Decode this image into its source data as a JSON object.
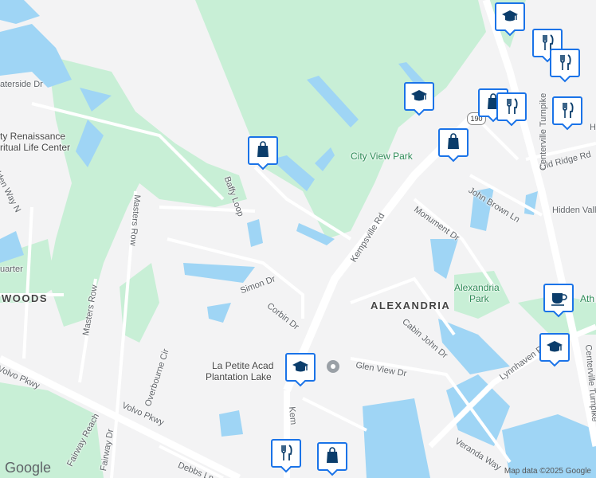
{
  "map": {
    "labels": {
      "waterside_dr": "aterside Dr",
      "renaissance": "ty Renaissance",
      "life_center": "ritual Life Center",
      "hidden_way": "dden Way N",
      "baffy_loop": "Baffy Loop",
      "masters_row_1": "Masters Row",
      "masters_row_2": "Masters Row",
      "quarter": "uarter",
      "woods": "WOODS",
      "simon_dr": "Simon Dr",
      "corbin_dr": "Corbin Dr",
      "kempsville_rd": "Kempsville Rd",
      "kempsville_rd_2": "Kem",
      "city_view_park": "City View Park",
      "john_brown_ln": "John Brown Ln",
      "monument_dr": "Monument Dr",
      "old_ridge_rd": "Old Ridge Rd",
      "hidden_valley": "Hidden Vall",
      "centerville_tpke_1": "Centerville Turnpike",
      "centerville_tpke_2": "Centerville Turnpike",
      "alexandria": "ALEXANDRIA",
      "alexandria_park_1": "Alexandria",
      "alexandria_park_2": "Park",
      "cabin_john_dr": "Cabin John Dr",
      "lynnhaven_pkwy": "Lynnhaven Pkwy",
      "glen_view_dr": "Glen View Dr",
      "la_petite_1": "La Petite Acad",
      "la_petite_2": "Plantation Lake",
      "overbourne_cir": "Overbourne Cir",
      "volvo_pkwy_1": "Volvo Pkwy",
      "volvo_pkwy_2": "Volvo Pkwy",
      "fairway_reach": "Fairway Reach",
      "fairway_dr": "Fairway Dr",
      "debbs_ln": "Debbs Ln",
      "veranda_way": "Veranda Way",
      "ath": "Ath",
      "h_edge": "H",
      "route_190": "190"
    },
    "attribution": "Map data ©2025 Google",
    "logo": "Google",
    "colors": {
      "water": "#9fd5f5",
      "park": "#c8efd6",
      "land": "#f3f3f4",
      "road": "#ffffff",
      "pin": "#1a73e8",
      "pin_dark": "#0b3d6b"
    },
    "pins": [
      {
        "name": "shopping-pin-golf",
        "icon": "shopping-bag-icon"
      },
      {
        "name": "school-pin-top",
        "icon": "graduation-cap-icon"
      },
      {
        "name": "school-pin-park",
        "icon": "graduation-cap-icon"
      },
      {
        "name": "shopping-pin-kempsville",
        "icon": "shopping-bag-icon"
      },
      {
        "name": "restaurant-pin-1",
        "icon": "fork-knife-icon"
      },
      {
        "name": "restaurant-pin-2",
        "icon": "fork-knife-icon"
      },
      {
        "name": "shopping-pin-cluster",
        "icon": "shopping-bag-icon"
      },
      {
        "name": "restaurant-pin-3",
        "icon": "fork-knife-icon"
      },
      {
        "name": "restaurant-pin-4",
        "icon": "fork-knife-icon"
      },
      {
        "name": "cafe-pin",
        "icon": "coffee-cup-icon"
      },
      {
        "name": "school-pin-lynnhaven",
        "icon": "graduation-cap-icon"
      },
      {
        "name": "school-pin-la-petite",
        "icon": "graduation-cap-icon"
      },
      {
        "name": "restaurant-pin-bottom",
        "icon": "fork-knife-icon"
      },
      {
        "name": "shopping-pin-bottom",
        "icon": "shopping-bag-icon"
      }
    ]
  }
}
